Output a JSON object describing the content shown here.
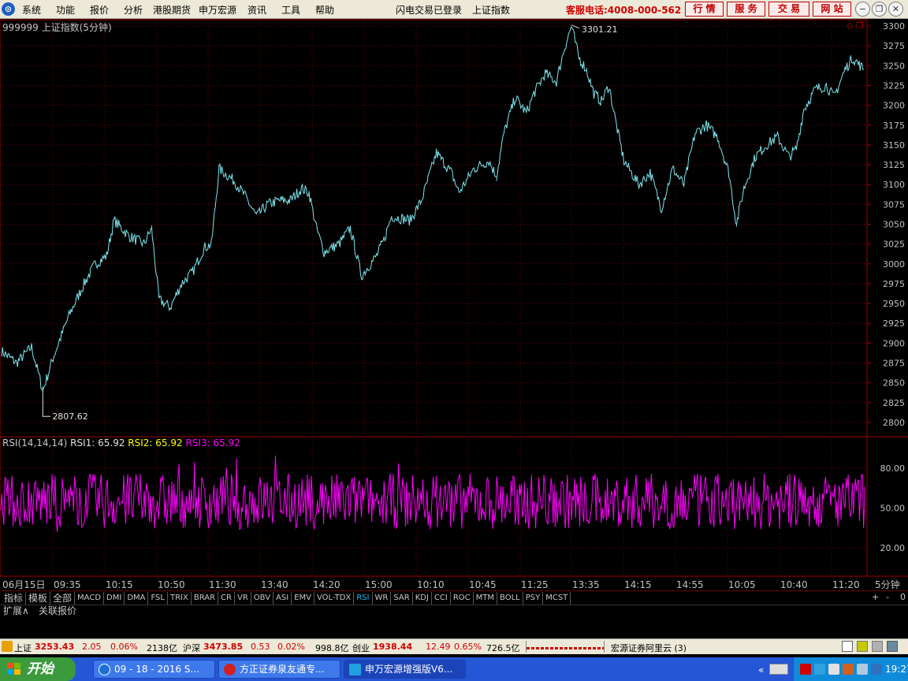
{
  "menu": {
    "items": [
      "系统",
      "功能",
      "报价",
      "分析",
      "港股期货",
      "申万宏源",
      "资讯",
      "工具",
      "帮助"
    ],
    "status_login": "闪电交易已登录",
    "index_name": "上证指数",
    "hotline": "客服电话:4008-000-562",
    "buttons": [
      "行 情",
      "服 务",
      "交 易",
      "网 站"
    ]
  },
  "chart_header": {
    "title": "999999 上证指数(5分钟)"
  },
  "rsi_legend": {
    "params": "RSI(14,14,14)",
    "rsi1": "RSI1: 65.92",
    "rsi2": "RSI2: 65.92",
    "rsi3": "RSI3: 65.92"
  },
  "bottom_right_label": "5分钟",
  "tabs": [
    "指标",
    "模板",
    "全部",
    "MACD",
    "DMI",
    "DMA",
    "FSL",
    "TRIX",
    "BRAR",
    "CR",
    "VR",
    "OBV",
    "ASI",
    "EMV",
    "VOL-TDX",
    "RSI",
    "WR",
    "SAR",
    "KDJ",
    "CCI",
    "ROC",
    "MTM",
    "BOLL",
    "PSY",
    "MCST"
  ],
  "active_tab": "RSI",
  "tab_controls": [
    "+",
    "-",
    "0"
  ],
  "subtabs": [
    "扩展∧",
    "关联报价"
  ],
  "status": {
    "sh_label": "上证",
    "sh_value": "3253.43",
    "sh_change": "2.05",
    "sh_pct": "0.06%",
    "sh_amount": "2138亿",
    "hs_label": "沪深",
    "hs_value": "3473.85",
    "hs_change": "0.53",
    "hs_pct": "0.02%",
    "hs_amount": "998.8亿",
    "cy_label": "创业",
    "cy_value": "1938.44",
    "cy_change": "12.49",
    "cy_pct": "0.65%",
    "cy_amount": "726.5亿",
    "broker": "宏源证券阿里云 (3)"
  },
  "taskbar": {
    "start_label": "开始",
    "tasks": [
      "09 - 18 - 2016 S...",
      "方正证券泉友通专...",
      "申万宏源增强版V6..."
    ],
    "clock": "19:27"
  },
  "chart_data": {
    "type": "line",
    "title": "999999 上证指数(5分钟)",
    "price_ticks": [
      2800,
      2825,
      2850,
      2875,
      2900,
      2925,
      2950,
      2975,
      3000,
      3025,
      3050,
      3075,
      3100,
      3125,
      3150,
      3175,
      3200,
      3225,
      3250,
      3275,
      3300
    ],
    "ylim": [
      2785,
      3306
    ],
    "annotations": {
      "high": "3301.21",
      "low": "2807.62"
    },
    "x_tick_labels": [
      "06月15日",
      "09:35",
      "10:15",
      "10:50",
      "11:30",
      "13:40",
      "14:20",
      "15:00",
      "10:10",
      "10:45",
      "11:25",
      "13:35",
      "14:15",
      "14:55",
      "10:05",
      "10:40",
      "11:20"
    ],
    "price_waypoints": [
      [
        0,
        2890
      ],
      [
        2,
        2875
      ],
      [
        4,
        2895
      ],
      [
        5.5,
        2840
      ],
      [
        7,
        2885
      ],
      [
        9,
        2935
      ],
      [
        11,
        2975
      ],
      [
        12.5,
        3000
      ],
      [
        14,
        3010
      ],
      [
        15,
        3055
      ],
      [
        17,
        3035
      ],
      [
        19,
        3025
      ],
      [
        20,
        3045
      ],
      [
        21,
        2955
      ],
      [
        22.5,
        2945
      ],
      [
        24,
        2975
      ],
      [
        25.5,
        2990
      ],
      [
        27,
        3020
      ],
      [
        28,
        3025
      ],
      [
        29,
        3120
      ],
      [
        31,
        3105
      ],
      [
        32.5,
        3085
      ],
      [
        34,
        3060
      ],
      [
        35.5,
        3075
      ],
      [
        37,
        3080
      ],
      [
        38.5,
        3080
      ],
      [
        40,
        3095
      ],
      [
        41,
        3090
      ],
      [
        42,
        3045
      ],
      [
        43,
        3015
      ],
      [
        45,
        3025
      ],
      [
        46.5,
        3045
      ],
      [
        48,
        2985
      ],
      [
        50,
        3010
      ],
      [
        51,
        3030
      ],
      [
        52,
        3060
      ],
      [
        54.5,
        3055
      ],
      [
        56,
        3080
      ],
      [
        58,
        3140
      ],
      [
        60,
        3115
      ],
      [
        61,
        3090
      ],
      [
        63,
        3120
      ],
      [
        65,
        3130
      ],
      [
        66,
        3110
      ],
      [
        67,
        3165
      ],
      [
        68.5,
        3210
      ],
      [
        70,
        3190
      ],
      [
        71,
        3215
      ],
      [
        72.5,
        3240
      ],
      [
        74,
        3230
      ],
      [
        75,
        3270
      ],
      [
        76,
        3300
      ],
      [
        77,
        3260
      ],
      [
        78,
        3245
      ],
      [
        79,
        3215
      ],
      [
        80,
        3205
      ],
      [
        81,
        3225
      ],
      [
        82,
        3175
      ],
      [
        83,
        3130
      ],
      [
        85,
        3100
      ],
      [
        86.5,
        3115
      ],
      [
        88,
        3070
      ],
      [
        89.5,
        3120
      ],
      [
        91,
        3100
      ],
      [
        92.5,
        3165
      ],
      [
        94,
        3175
      ],
      [
        95.5,
        3160
      ],
      [
        97,
        3115
      ],
      [
        98,
        3050
      ],
      [
        99,
        3095
      ],
      [
        100.5,
        3135
      ],
      [
        102,
        3150
      ],
      [
        103.5,
        3160
      ],
      [
        105,
        3135
      ],
      [
        106,
        3145
      ],
      [
        107,
        3195
      ],
      [
        108.5,
        3220
      ],
      [
        110,
        3225
      ],
      [
        111,
        3210
      ],
      [
        112.5,
        3245
      ],
      [
        113.5,
        3260
      ],
      [
        115,
        3245
      ]
    ],
    "x_max": 115,
    "gaps": [
      20,
      41,
      66,
      78,
      98
    ],
    "rsi_ticks": [
      20.0,
      50.0,
      80.0
    ],
    "rsi_ylim": [
      0,
      100
    ],
    "rsi_series": [
      {
        "name": "RSI1",
        "color": "#ff00ff",
        "last": 65.92
      },
      {
        "name": "RSI2",
        "color": "#ffff00",
        "last": 65.92
      },
      {
        "name": "RSI3",
        "color": "#ff00ff",
        "last": 65.92
      }
    ]
  }
}
